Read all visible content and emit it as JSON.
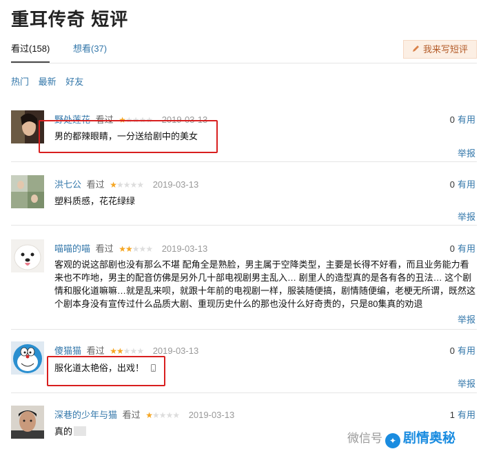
{
  "page": {
    "title": "重耳传奇 短评"
  },
  "tabs": {
    "active_label": "看过(158)",
    "inactive_label": "想看(37)",
    "write_label": "我来写短评"
  },
  "sort": {
    "hot": "热门",
    "latest": "最新",
    "friends": "好友"
  },
  "comments": [
    {
      "user": "野处莲花",
      "watched": "看过",
      "rating": 1,
      "date": "2019-03-13",
      "votes": "0",
      "useful": "有用",
      "text": "男的都辣眼睛，一分送给剧中的美女",
      "report": "举报"
    },
    {
      "user": "洪七公",
      "watched": "看过",
      "rating": 1,
      "date": "2019-03-13",
      "votes": "0",
      "useful": "有用",
      "text": "塑料质感，花花绿绿",
      "report": "举报"
    },
    {
      "user": "喵喵的喵",
      "watched": "看过",
      "rating": 2,
      "date": "2019-03-13",
      "votes": "0",
      "useful": "有用",
      "text_lines": [
        "客观的说这部剧也没有那么不堪 配角全是熟脸，男主属于空降类型，主要是长得不好看，而且业务能力看",
        "来也不咋地，男主的配音仿佛是另外几十部电视剧男主乱入… 剧里人的造型真的是各有各的丑法… 这个剧",
        "情和服化道嘛嘛…就是乱来呗，就跟十年前的电视剧一样，服装随便搞，剧情随便编，老梗无所谓，既然这",
        "个剧本身没有宣传过什么品质大剧、重现历史什么的那也没什么好奇责的，只是80集真的劝退"
      ],
      "report": "举报"
    },
    {
      "user": "傻猫猫",
      "watched": "看过",
      "rating": 2,
      "date": "2019-03-13",
      "votes": "0",
      "useful": "有用",
      "text": "服化道太艳俗，出戏！",
      "report": "举报"
    },
    {
      "user": "深巷的少年与猫",
      "watched": "看过",
      "rating": 1,
      "date": "2019-03-13",
      "votes": "1",
      "useful": "有用",
      "text": "真的",
      "report": ""
    }
  ],
  "watermark": {
    "prefix": "微信号",
    "name": "剧情奥秘"
  },
  "colors": {
    "link": "#3377aa",
    "star": "#f5a623",
    "highlight": "#d81e1e",
    "write_bg": "#fcefe4"
  }
}
